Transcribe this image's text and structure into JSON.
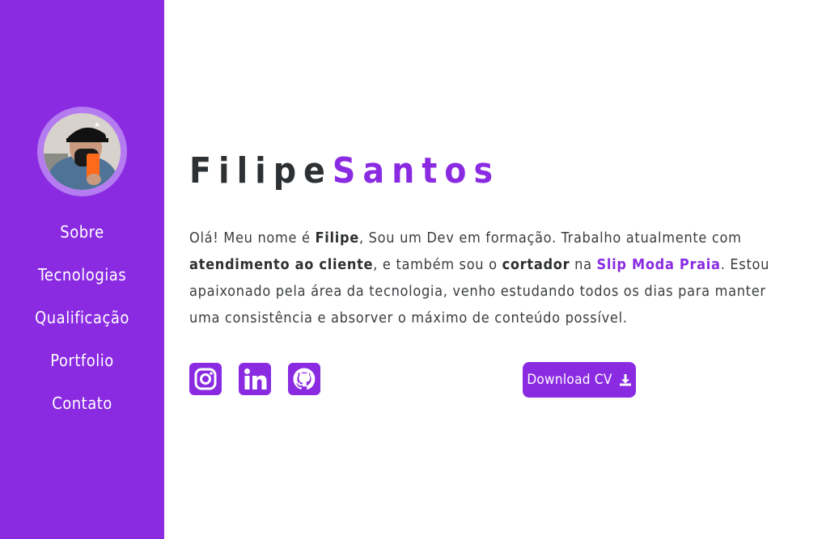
{
  "sidebar": {
    "avatar_alt": "Filipe Santos",
    "nav": [
      {
        "label": "Sobre"
      },
      {
        "label": "Tecnologias"
      },
      {
        "label": "Qualificação"
      },
      {
        "label": "Portfolio"
      },
      {
        "label": "Contato"
      }
    ]
  },
  "hero": {
    "first_name": "Filipe",
    "last_name": "Santos",
    "about": {
      "p1": "Olá! Meu nome é ",
      "b1": "Filipe",
      "p2": ", Sou um Dev em formação. Trabalho atualmente com ",
      "b2": "atendimento ao cliente",
      "p3": ", e também sou o ",
      "b3": "cortador",
      "p4": " na ",
      "company": "Slip Moda Praia",
      "p5": ". Estou apaixonado pela área da tecnologia, venho estudando todos os dias para manter uma consistência e absorver o máximo de conteúdo possível."
    },
    "social": [
      {
        "icon": "instagram-icon"
      },
      {
        "icon": "linkedin-icon"
      },
      {
        "icon": "github-icon"
      }
    ],
    "cv_label": "Download CV",
    "cv_icon": "download-icon"
  },
  "colors": {
    "accent": "#8a2be2",
    "text": "#3a3d40"
  }
}
